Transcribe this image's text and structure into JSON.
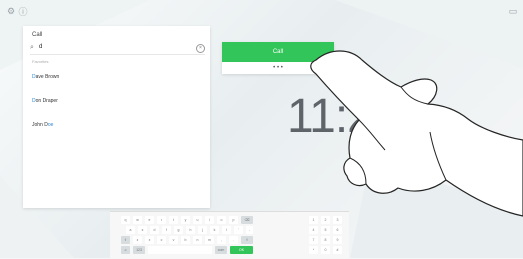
{
  "top": {
    "left_icons": [
      "gear-icon",
      "info-icon"
    ],
    "right_icon": "screen-share-icon"
  },
  "search_panel": {
    "title": "Call",
    "query": "d",
    "section_label": "Favorites",
    "contacts": [
      {
        "hl": "D",
        "rest": "ave Brown"
      },
      {
        "hl": "D",
        "rest": "on Draper"
      },
      {
        "hl": "",
        "rest": "John D",
        "tail_hl": "oe"
      }
    ]
  },
  "call_popup": {
    "call_label": "Call",
    "more_label": "• • •"
  },
  "clock": {
    "time": "11:2"
  },
  "keyboard": {
    "rows": [
      [
        "q",
        "w",
        "e",
        "r",
        "t",
        "y",
        "u",
        "i",
        "o",
        "p",
        "⌫"
      ],
      [
        "a",
        "s",
        "d",
        "f",
        "g",
        "h",
        "j",
        "k",
        "l",
        "'",
        "-"
      ],
      [
        "⇧",
        "z",
        "x",
        "c",
        "v",
        "b",
        "n",
        "m",
        ",",
        ".",
        "⇧"
      ],
      [
        "☺",
        "123",
        "",
        "",
        "",
        " ",
        "",
        "",
        "com",
        "OK"
      ]
    ],
    "numpad": [
      [
        "1",
        "2",
        "3"
      ],
      [
        "4",
        "5",
        "6"
      ],
      [
        "7",
        "8",
        "9"
      ],
      [
        "*",
        "0",
        "#"
      ]
    ]
  },
  "colors": {
    "accent": "#32c55a",
    "highlight": "#2f89d7",
    "text": "#333333"
  }
}
